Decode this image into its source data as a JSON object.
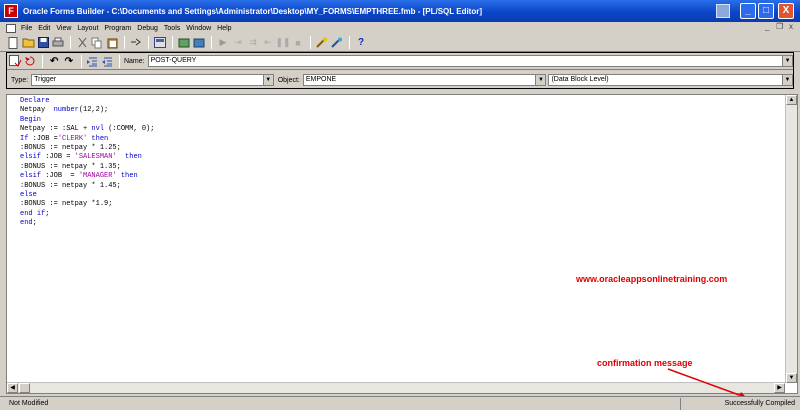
{
  "window": {
    "title": "Oracle Forms Builder - C:\\Documents and Settings\\Administrator\\Desktop\\MY_FORMS\\EMPTHREE.fmb - [PL/SQL Editor]",
    "minimize": "_",
    "maximize": "□",
    "close": "X"
  },
  "menu": {
    "items": [
      "File",
      "Edit",
      "View",
      "Layout",
      "Program",
      "Debug",
      "Tools",
      "Window",
      "Help"
    ],
    "mdi_minimize": "_",
    "mdi_restore": "❐",
    "mdi_close": "x"
  },
  "toolbar": {
    "help_label": "?"
  },
  "editor_header": {
    "name_label": "Name:",
    "name_value": "POST-QUERY",
    "type_label": "Type:",
    "type_value": "Trigger",
    "object_label": "Object:",
    "object_value": "EMPONE",
    "level_value": "(Data Block Level)"
  },
  "code": {
    "lines": [
      "Declare",
      "Netpay  number(12,2);",
      "Begin",
      "Netpay := :SAL + nvl (:COMM, 0);",
      "If :JOB ='CLERK' then",
      ":BONUS := netpay * 1.25;",
      "elsif :JOB = 'SALESMAN'  then",
      ":BONUS := netpay * 1.35;",
      "elsif :JOB  = 'MANAGER' then",
      ":BONUS := netpay * 1.45;",
      "else",
      ":BONUS := netpay *1.9;",
      "end if;",
      "end;"
    ]
  },
  "overlay": {
    "watermark": "www.oracleappsonlinetraining.com",
    "annotation": "confirmation message"
  },
  "status": {
    "left": "Not Modified",
    "right": "Successfully Compiled"
  },
  "colors": {
    "titlebar": "#0a46c8",
    "keyword": "#0000cc",
    "string": "#a000a0",
    "annotation": "#e00000"
  }
}
